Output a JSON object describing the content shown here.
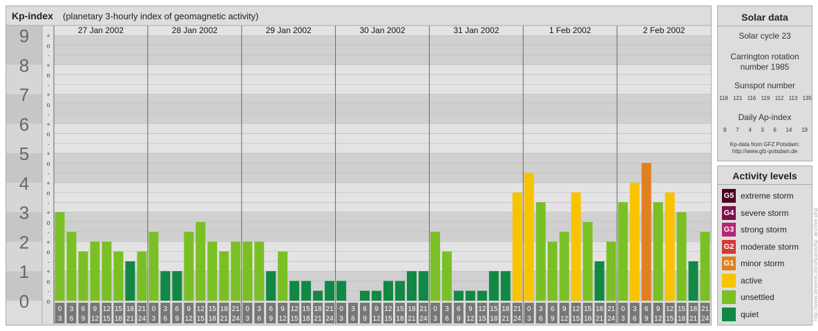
{
  "header": {
    "title": "Kp-index",
    "subtitle": "(planetary 3-hourly index of geomagnetic activity)"
  },
  "chart_data": {
    "type": "bar",
    "y_range": [
      0,
      9
    ],
    "y_major_ticks": [
      "0",
      "1",
      "2",
      "3",
      "4",
      "5",
      "6",
      "7",
      "8",
      "9"
    ],
    "y_minor_labels": [
      "-",
      "o",
      "+"
    ],
    "days": [
      "27 Jan 2002",
      "28 Jan 2002",
      "29 Jan 2002",
      "30 Jan 2002",
      "31 Jan 2002",
      "1 Feb 2002",
      "2 Feb 2002"
    ],
    "hour_intervals": [
      [
        "0",
        "3"
      ],
      [
        "3",
        "6"
      ],
      [
        "6",
        "9"
      ],
      [
        "9",
        "12"
      ],
      [
        "12",
        "15"
      ],
      [
        "15",
        "18"
      ],
      [
        "18",
        "21"
      ],
      [
        "21",
        "24"
      ]
    ],
    "kp_values": [
      [
        3.0,
        2.333,
        1.667,
        2.0,
        2.0,
        1.667,
        1.333,
        1.667
      ],
      [
        2.333,
        1.0,
        1.0,
        2.333,
        2.667,
        2.0,
        1.667,
        2.0
      ],
      [
        2.0,
        2.0,
        1.0,
        1.667,
        0.667,
        0.667,
        0.333,
        0.667
      ],
      [
        0.667,
        0.0,
        0.333,
        0.333,
        0.667,
        0.667,
        1.0,
        1.0
      ],
      [
        2.333,
        1.667,
        0.333,
        0.333,
        0.333,
        1.0,
        1.0,
        3.667
      ],
      [
        4.333,
        3.333,
        2.0,
        2.333,
        3.667,
        2.667,
        1.333,
        2.0
      ],
      [
        3.333,
        4.0,
        4.667,
        3.333,
        3.667,
        3.0,
        1.333,
        2.333
      ]
    ],
    "level_colors": {
      "quiet": "#118844",
      "unsettled": "#7ac025",
      "active": "#f8c300",
      "minor_storm": "#e08020",
      "moderate_storm": "#d63838",
      "strong_storm": "#b52474",
      "severe_storm": "#7e0e4d",
      "extreme_storm": "#4c0022"
    }
  },
  "solar": {
    "title": "Solar data",
    "cycle": "Solar cycle 23",
    "carrington_line1": "Carrington rotation",
    "carrington_line2": "number 1985",
    "sunspot_label": "Sunspot number",
    "sunspot_values": [
      "118",
      "121",
      "116",
      "119",
      "112",
      "113",
      "135"
    ],
    "ap_label": "Daily Ap-index",
    "ap_values": [
      "8",
      "7",
      "4",
      "3",
      "6",
      "14",
      "19"
    ],
    "source_line1": "Kp-data from GFZ Potsdam:",
    "source_line2": "http://www.gfz-potsdam.de"
  },
  "activity": {
    "title": "Activity levels",
    "items": [
      {
        "code": "G5",
        "label": "extreme storm",
        "color": "#4c0022"
      },
      {
        "code": "G4",
        "label": "severe storm",
        "color": "#7e0e4d"
      },
      {
        "code": "G3",
        "label": "strong storm",
        "color": "#b52474"
      },
      {
        "code": "G2",
        "label": "moderate storm",
        "color": "#d63838"
      },
      {
        "code": "G1",
        "label": "minor storm",
        "color": "#e08020"
      },
      {
        "code": "",
        "label": "active",
        "color": "#f8c300"
      },
      {
        "code": "",
        "label": "unsettled",
        "color": "#7ac025"
      },
      {
        "code": "",
        "label": "quiet",
        "color": "#118844"
      }
    ]
  },
  "credit": "http://www.tiesenet.de/ulfpatsk/kp_archive.php"
}
